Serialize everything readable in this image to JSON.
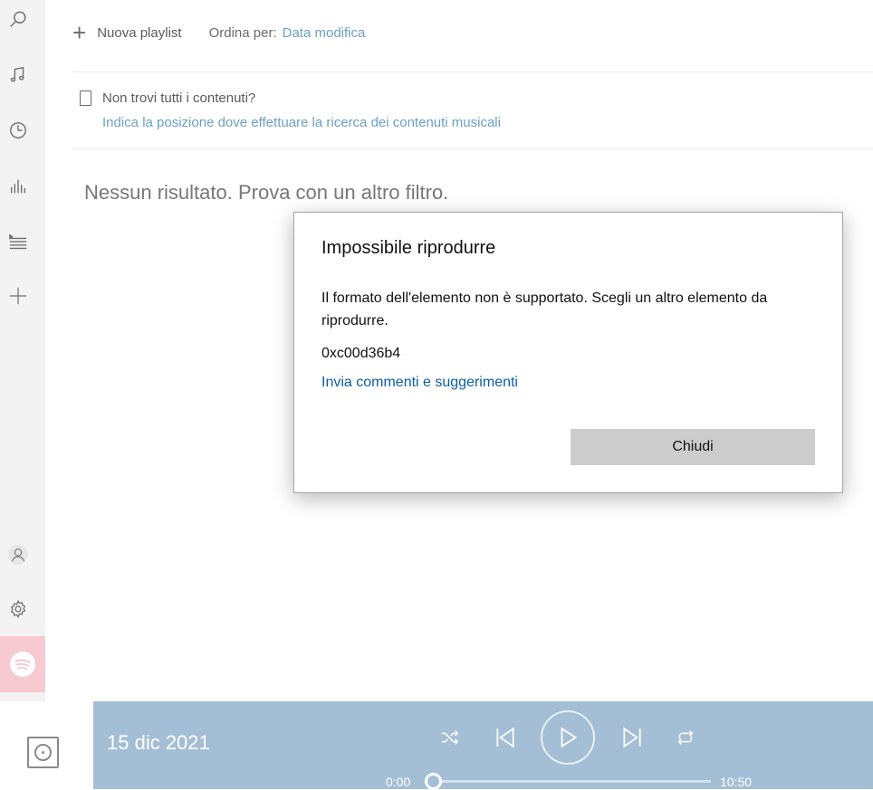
{
  "toolbar": {
    "new_playlist_label": "Nuova playlist",
    "sort_label": "Ordina per:",
    "sort_value": "Data modifica"
  },
  "missing_content": {
    "question": "Non trovi tutti i contenuti?",
    "link": "Indica la posizione dove effettuare la ricerca dei contenuti musicali"
  },
  "main": {
    "empty_message": "Nessun risultato. Prova con un altro filtro."
  },
  "dialog": {
    "title": "Impossibile riprodurre",
    "message": "Il formato dell'elemento non è supportato. Scegli un altro elemento da riprodurre.",
    "error_code": "0xc00d36b4",
    "feedback_link": "Invia commenti e suggerimenti",
    "close_button": "Chiudi"
  },
  "player": {
    "track_title": "15 dic 2021",
    "current_time": "0:00",
    "total_time": "10:50",
    "progress": 0.0
  },
  "colors": {
    "accent_link": "#6aa0c2",
    "player_bg": "#a4bfd5",
    "dialog_link": "#0b5ea8",
    "spotify_bg": "#f7c9d0"
  },
  "icons": {
    "rail": [
      "search-icon",
      "music-note-icon",
      "clock-icon",
      "equalizer-icon",
      "playlist-icon",
      "plus-icon",
      "user-icon",
      "settings-icon",
      "spotify-icon"
    ],
    "player": [
      "shuffle-icon",
      "previous-icon",
      "play-icon",
      "next-icon",
      "repeat-icon",
      "album-icon"
    ]
  }
}
